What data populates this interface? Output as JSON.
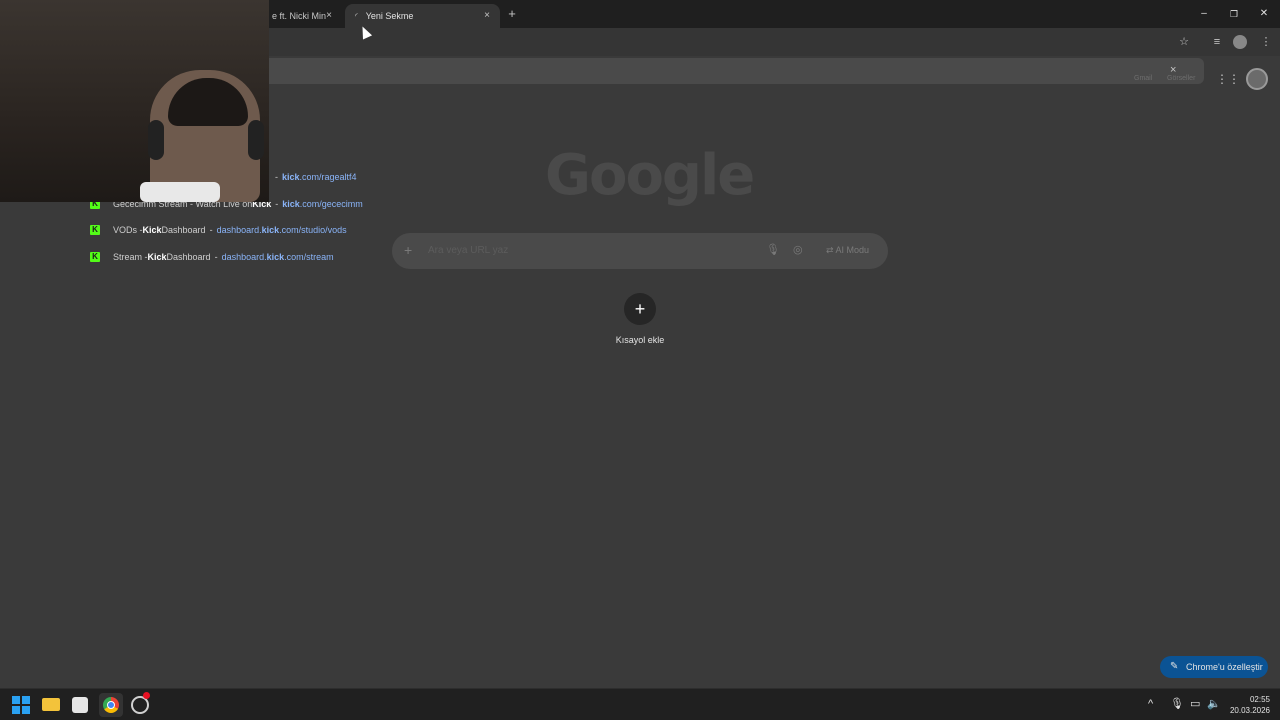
{
  "browser": {
    "tabs": [
      {
        "title": "e ft. Nicki Min",
        "close": "×"
      },
      {
        "title": "Yeni Sekme",
        "close": "×"
      }
    ],
    "new_tab": "+",
    "window_controls": {
      "minimize": "–",
      "restore": "❐",
      "close": "✕"
    }
  },
  "toolbar": {
    "icons": [
      "star-icon",
      "media-control-icon",
      "profile-icon",
      "menu-icon"
    ]
  },
  "dropdown": {
    "close": "×",
    "header_links": {
      "gmail": "Gmail",
      "images": "Görseller"
    },
    "suggestions": [
      {
        "prefix": "",
        "bold": "",
        "suffix": "",
        "url_plain": "",
        "url_bold": "kick",
        "url_rest": ".com/ragealtf4"
      },
      {
        "prefix": "Gececimm Stream - Watch Live on ",
        "bold": "Kick",
        "suffix": "",
        "url_plain": "",
        "url_bold": "kick",
        "url_rest": ".com/gececimm"
      },
      {
        "prefix": "VODs - ",
        "bold": "Kick",
        "suffix": " Dashboard",
        "url_plain": "dashboard.",
        "url_bold": "kick",
        "url_rest": ".com/studio/vods"
      },
      {
        "prefix": "Stream - ",
        "bold": "Kick",
        "suffix": " Dashboard",
        "url_plain": "dashboard.",
        "url_bold": "kick",
        "url_rest": ".com/stream"
      }
    ]
  },
  "ntp": {
    "logo": "Google",
    "search_placeholder": "Ara veya URL yaz",
    "ai_mode": "AI Modu",
    "shortcut_add_label": "Kısayol ekle",
    "customize_label": "Chrome'u özelleştir"
  },
  "taskbar": {
    "time": "02:55",
    "date": "20.03.2026"
  },
  "colors": {
    "kick_green": "#53fc18",
    "link_blue": "#8ab4f8",
    "customize_blue": "#0b5394"
  }
}
